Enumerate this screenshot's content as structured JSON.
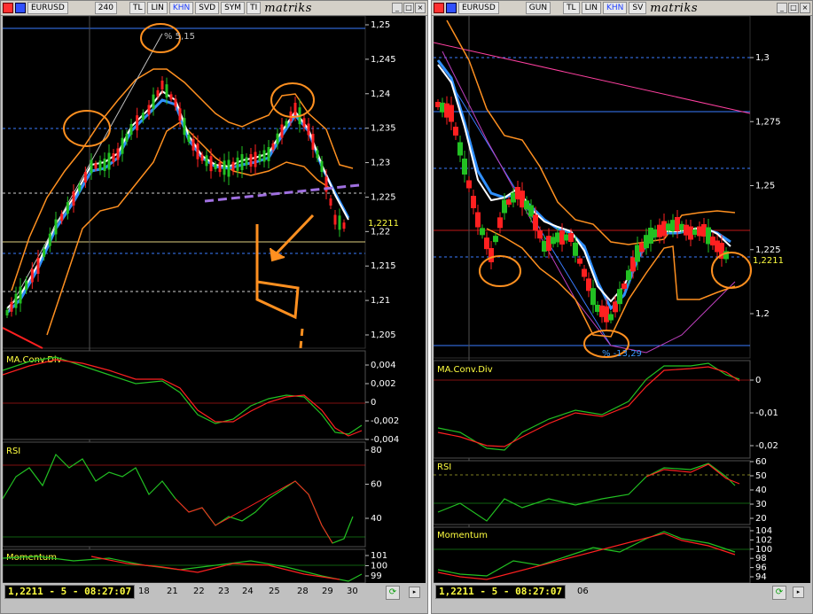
{
  "left": {
    "toolbar": [
      "EURUSD",
      "240",
      "TL",
      "LIN",
      "KHN",
      "SVD",
      "SYM",
      "TI"
    ],
    "logo": "matriks",
    "price_ticks": [
      "1,25",
      "1,245",
      "1,24",
      "1,235",
      "1,23",
      "1,225",
      "1,22",
      "1,215",
      "1,21",
      "1,205"
    ],
    "last_price": "1,2211",
    "annotation": "% 5,15",
    "panels": {
      "macd": {
        "title": "MA.Conv.Div",
        "ticks": [
          "0,004",
          "0,002",
          "0",
          "-0,002",
          "-0,004"
        ]
      },
      "rsi": {
        "title": "RSI",
        "ticks": [
          "80",
          "60",
          "40"
        ]
      },
      "momentum": {
        "title": "Momentum",
        "ticks": [
          "101",
          "100",
          "99"
        ]
      }
    },
    "status": "1,2211 - 5 - 08:27:07",
    "dates": [
      "18",
      "21",
      "22",
      "23",
      "24",
      "25",
      "28",
      "29",
      "30"
    ]
  },
  "right": {
    "toolbar": [
      "EURUSD",
      "GUN",
      "TL",
      "LIN",
      "KHN",
      "SV"
    ],
    "logo": "matriks",
    "price_ticks": [
      "1,3",
      "1,275",
      "1,25",
      "1,225",
      "1,2"
    ],
    "last_price": "1,2211",
    "annotation": "% -13,29",
    "panels": {
      "macd": {
        "title": "MA.Conv.Div",
        "ticks": [
          "0",
          "-0,01",
          "-0,02"
        ]
      },
      "rsi": {
        "title": "RSI",
        "ticks": [
          "60",
          "50",
          "40",
          "30",
          "20"
        ]
      },
      "momentum": {
        "title": "Momentum",
        "ticks": [
          "104",
          "102",
          "100",
          "98",
          "96",
          "94"
        ]
      }
    },
    "status": "1,2211 - 5 - 08:27:07",
    "dates": [
      "06"
    ]
  },
  "colors": {
    "bull": "#22c022",
    "bear": "#ff2020",
    "ma_white": "#ffffff",
    "ma_blue": "#3090ff",
    "band_orange": "#ff9020",
    "trend_violet": "#a070e0"
  }
}
